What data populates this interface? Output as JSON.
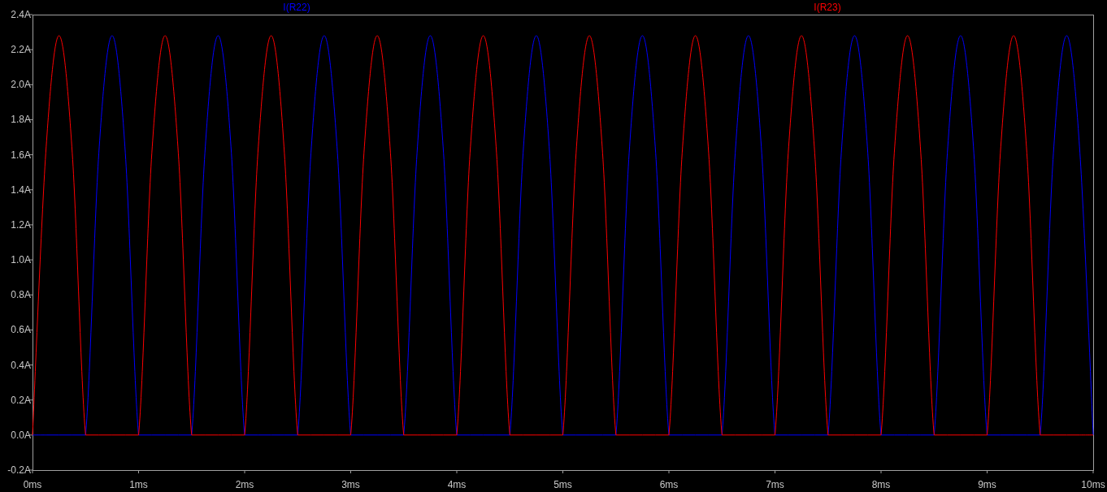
{
  "plot": {
    "chart_data": {
      "type": "line",
      "x": [
        0,
        0.125,
        0.25,
        0.375,
        0.5,
        0.625,
        0.75,
        0.875,
        1,
        1.125,
        1.25,
        1.375,
        1.5,
        1.625,
        1.75,
        1.875,
        2,
        2.125,
        2.25,
        2.375,
        2.5,
        2.625,
        2.75,
        2.875,
        3,
        3.125,
        3.25,
        3.375,
        3.5,
        3.625,
        3.75,
        3.875,
        4,
        4.125,
        4.25,
        4.375,
        4.5,
        4.625,
        4.75,
        4.875,
        5,
        5.125,
        5.25,
        5.375,
        5.5,
        5.625,
        5.75,
        5.875,
        6,
        6.125,
        6.25,
        6.375,
        6.5,
        6.625,
        6.75,
        6.875,
        7,
        7.125,
        7.25,
        7.375,
        7.5,
        7.625,
        7.75,
        7.875,
        8,
        8.125,
        8.25,
        8.375,
        8.5,
        8.625,
        8.75,
        8.875,
        9,
        9.125,
        9.25,
        9.375,
        9.5,
        9.625,
        9.75,
        9.875,
        10
      ],
      "series": [
        {
          "name": "I(R22)",
          "color": "#0000ff",
          "values": [
            0,
            0,
            0,
            0,
            0,
            1.61,
            2.28,
            1.61,
            0,
            0,
            0,
            0,
            0,
            1.61,
            2.28,
            1.61,
            0,
            0,
            0,
            0,
            0,
            1.61,
            2.28,
            1.61,
            0,
            0,
            0,
            0,
            0,
            1.61,
            2.28,
            1.61,
            0,
            0,
            0,
            0,
            0,
            1.61,
            2.28,
            1.61,
            0,
            0,
            0,
            0,
            0,
            1.61,
            2.28,
            1.61,
            0,
            0,
            0,
            0,
            0,
            1.61,
            2.28,
            1.61,
            0,
            0,
            0,
            0,
            0,
            1.61,
            2.28,
            1.61,
            0,
            0,
            0,
            0,
            0,
            1.61,
            2.28,
            1.61,
            0,
            0,
            0,
            0,
            0,
            1.61,
            2.28,
            1.61,
            0
          ]
        },
        {
          "name": "I(R23)",
          "color": "#ff0000",
          "values": [
            0,
            1.61,
            2.28,
            1.61,
            0,
            0,
            0,
            0,
            0,
            1.61,
            2.28,
            1.61,
            0,
            0,
            0,
            0,
            0,
            1.61,
            2.28,
            1.61,
            0,
            0,
            0,
            0,
            0,
            1.61,
            2.28,
            1.61,
            0,
            0,
            0,
            0,
            0,
            1.61,
            2.28,
            1.61,
            0,
            0,
            0,
            0,
            0,
            1.61,
            2.28,
            1.61,
            0,
            0,
            0,
            0,
            0,
            1.61,
            2.28,
            1.61,
            0,
            0,
            0,
            0,
            0,
            1.61,
            2.28,
            1.61,
            0,
            0,
            0,
            0,
            0,
            1.61,
            2.28,
            1.61,
            0,
            0,
            0,
            0,
            0,
            1.61,
            2.28,
            1.61,
            0,
            0,
            0,
            0,
            0
          ]
        }
      ],
      "xlim": [
        0,
        10
      ],
      "ylim": [
        -0.2,
        2.4
      ],
      "xticks": [
        {
          "value": 0,
          "label": "0ms"
        },
        {
          "value": 1,
          "label": "1ms"
        },
        {
          "value": 2,
          "label": "2ms"
        },
        {
          "value": 3,
          "label": "3ms"
        },
        {
          "value": 4,
          "label": "4ms"
        },
        {
          "value": 5,
          "label": "5ms"
        },
        {
          "value": 6,
          "label": "6ms"
        },
        {
          "value": 7,
          "label": "7ms"
        },
        {
          "value": 8,
          "label": "8ms"
        },
        {
          "value": 9,
          "label": "9ms"
        },
        {
          "value": 10,
          "label": "10ms"
        }
      ],
      "yticks": [
        {
          "value": -0.2,
          "label": "-0.2A"
        },
        {
          "value": 0,
          "label": "0.0A"
        },
        {
          "value": 0.2,
          "label": "0.2A"
        },
        {
          "value": 0.4,
          "label": "0.4A"
        },
        {
          "value": 0.6,
          "label": "0.6A"
        },
        {
          "value": 0.8,
          "label": "0.8A"
        },
        {
          "value": 1,
          "label": "1.0A"
        },
        {
          "value": 1.2,
          "label": "1.2A"
        },
        {
          "value": 1.4,
          "label": "1.4A"
        },
        {
          "value": 1.6,
          "label": "1.6A"
        },
        {
          "value": 1.8,
          "label": "1.8A"
        },
        {
          "value": 2,
          "label": "2.0A"
        },
        {
          "value": 2.2,
          "label": "2.2A"
        },
        {
          "value": 2.4,
          "label": "2.4A"
        }
      ]
    }
  }
}
